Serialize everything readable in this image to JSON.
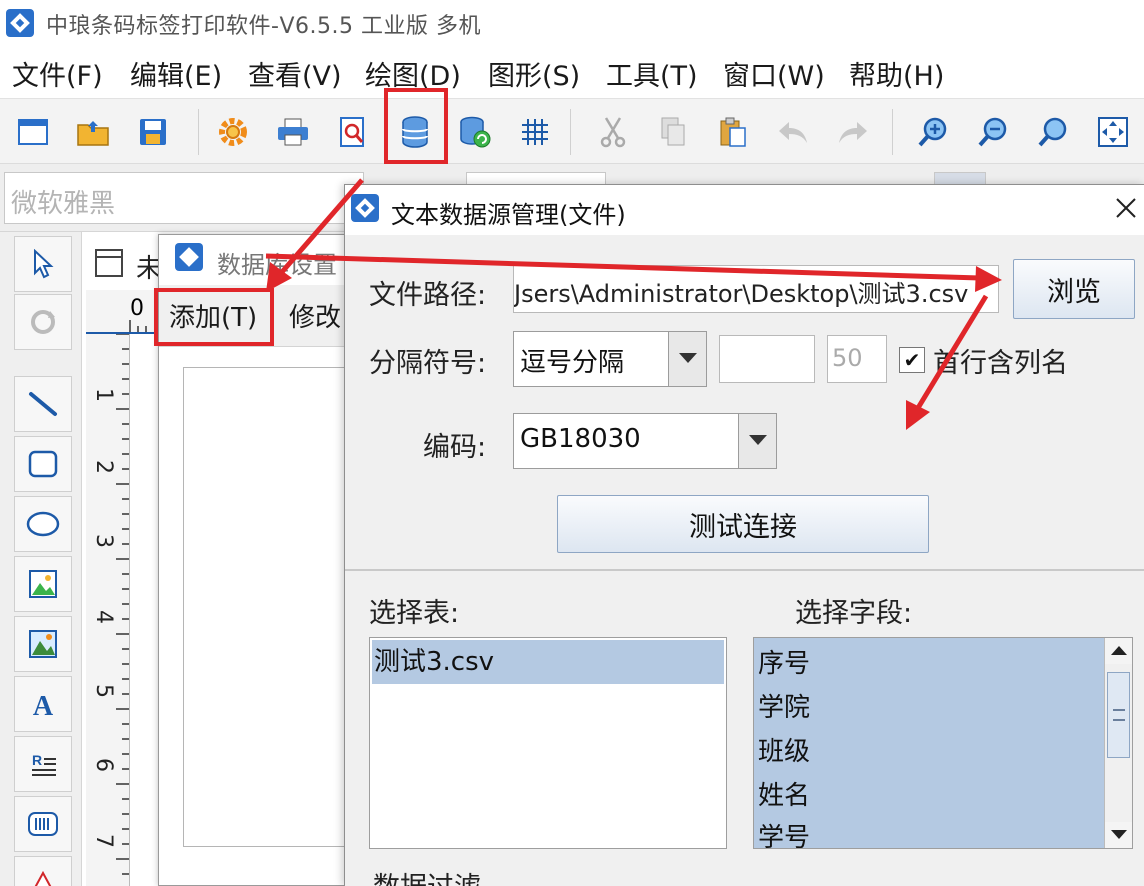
{
  "app": {
    "title": "中琅条码标签打印软件-V6.5.5 工业版 多机"
  },
  "menu": {
    "file": "文件(F)",
    "edit": "编辑(E)",
    "view": "查看(V)",
    "draw": "绘图(D)",
    "shape": "图形(S)",
    "tools": "工具(T)",
    "window": "窗口(W)",
    "help": "帮助(H)"
  },
  "toolbar": {
    "icons": [
      "new-icon",
      "open-icon",
      "save-icon",
      "settings-icon",
      "print-icon",
      "print-preview-icon",
      "database-icon",
      "database-refresh-icon",
      "grid-icon",
      "cut-icon",
      "copy-icon",
      "paste-icon",
      "undo-icon",
      "redo-icon",
      "zoom-in-icon",
      "zoom-out-icon",
      "zoom-icon",
      "fit-icon"
    ],
    "highlight_color": "#e0262a"
  },
  "fontbar": {
    "font_placeholder": "微软雅黑"
  },
  "document": {
    "tab_label": "未",
    "ruler_h_zero": "0",
    "ruler_v_numbers": [
      "1",
      "2",
      "3",
      "4",
      "5",
      "6",
      "7"
    ]
  },
  "db_dialog": {
    "title": "数据库设置",
    "add_label": "添加(T)",
    "edit_label": "修改"
  },
  "text_source_dialog": {
    "title": "文本数据源管理(文件)",
    "file_path_label": "文件路径:",
    "file_path_value": "Jsers\\Administrator\\Desktop\\测试3.csv",
    "browse_label": "浏览",
    "separator_label": "分隔符号:",
    "separator_value": "逗号分隔",
    "custom_sep_value": "",
    "length_value": "50",
    "first_row_label": "首行含列名",
    "first_row_checked": "✔",
    "encoding_label": "编码:",
    "encoding_value": "GB18030",
    "test_label": "测试连接",
    "select_table_label": "选择表:",
    "select_field_label": "选择字段:",
    "tables": [
      "测试3.csv"
    ],
    "fields": [
      "序号",
      "学院",
      "班级",
      "姓名",
      "学号"
    ],
    "data_filter_label": "数据过滤"
  },
  "colors": {
    "accent": "#2a6fc9",
    "selection": "#b4c9e2",
    "annotation_red": "#e0262a"
  }
}
